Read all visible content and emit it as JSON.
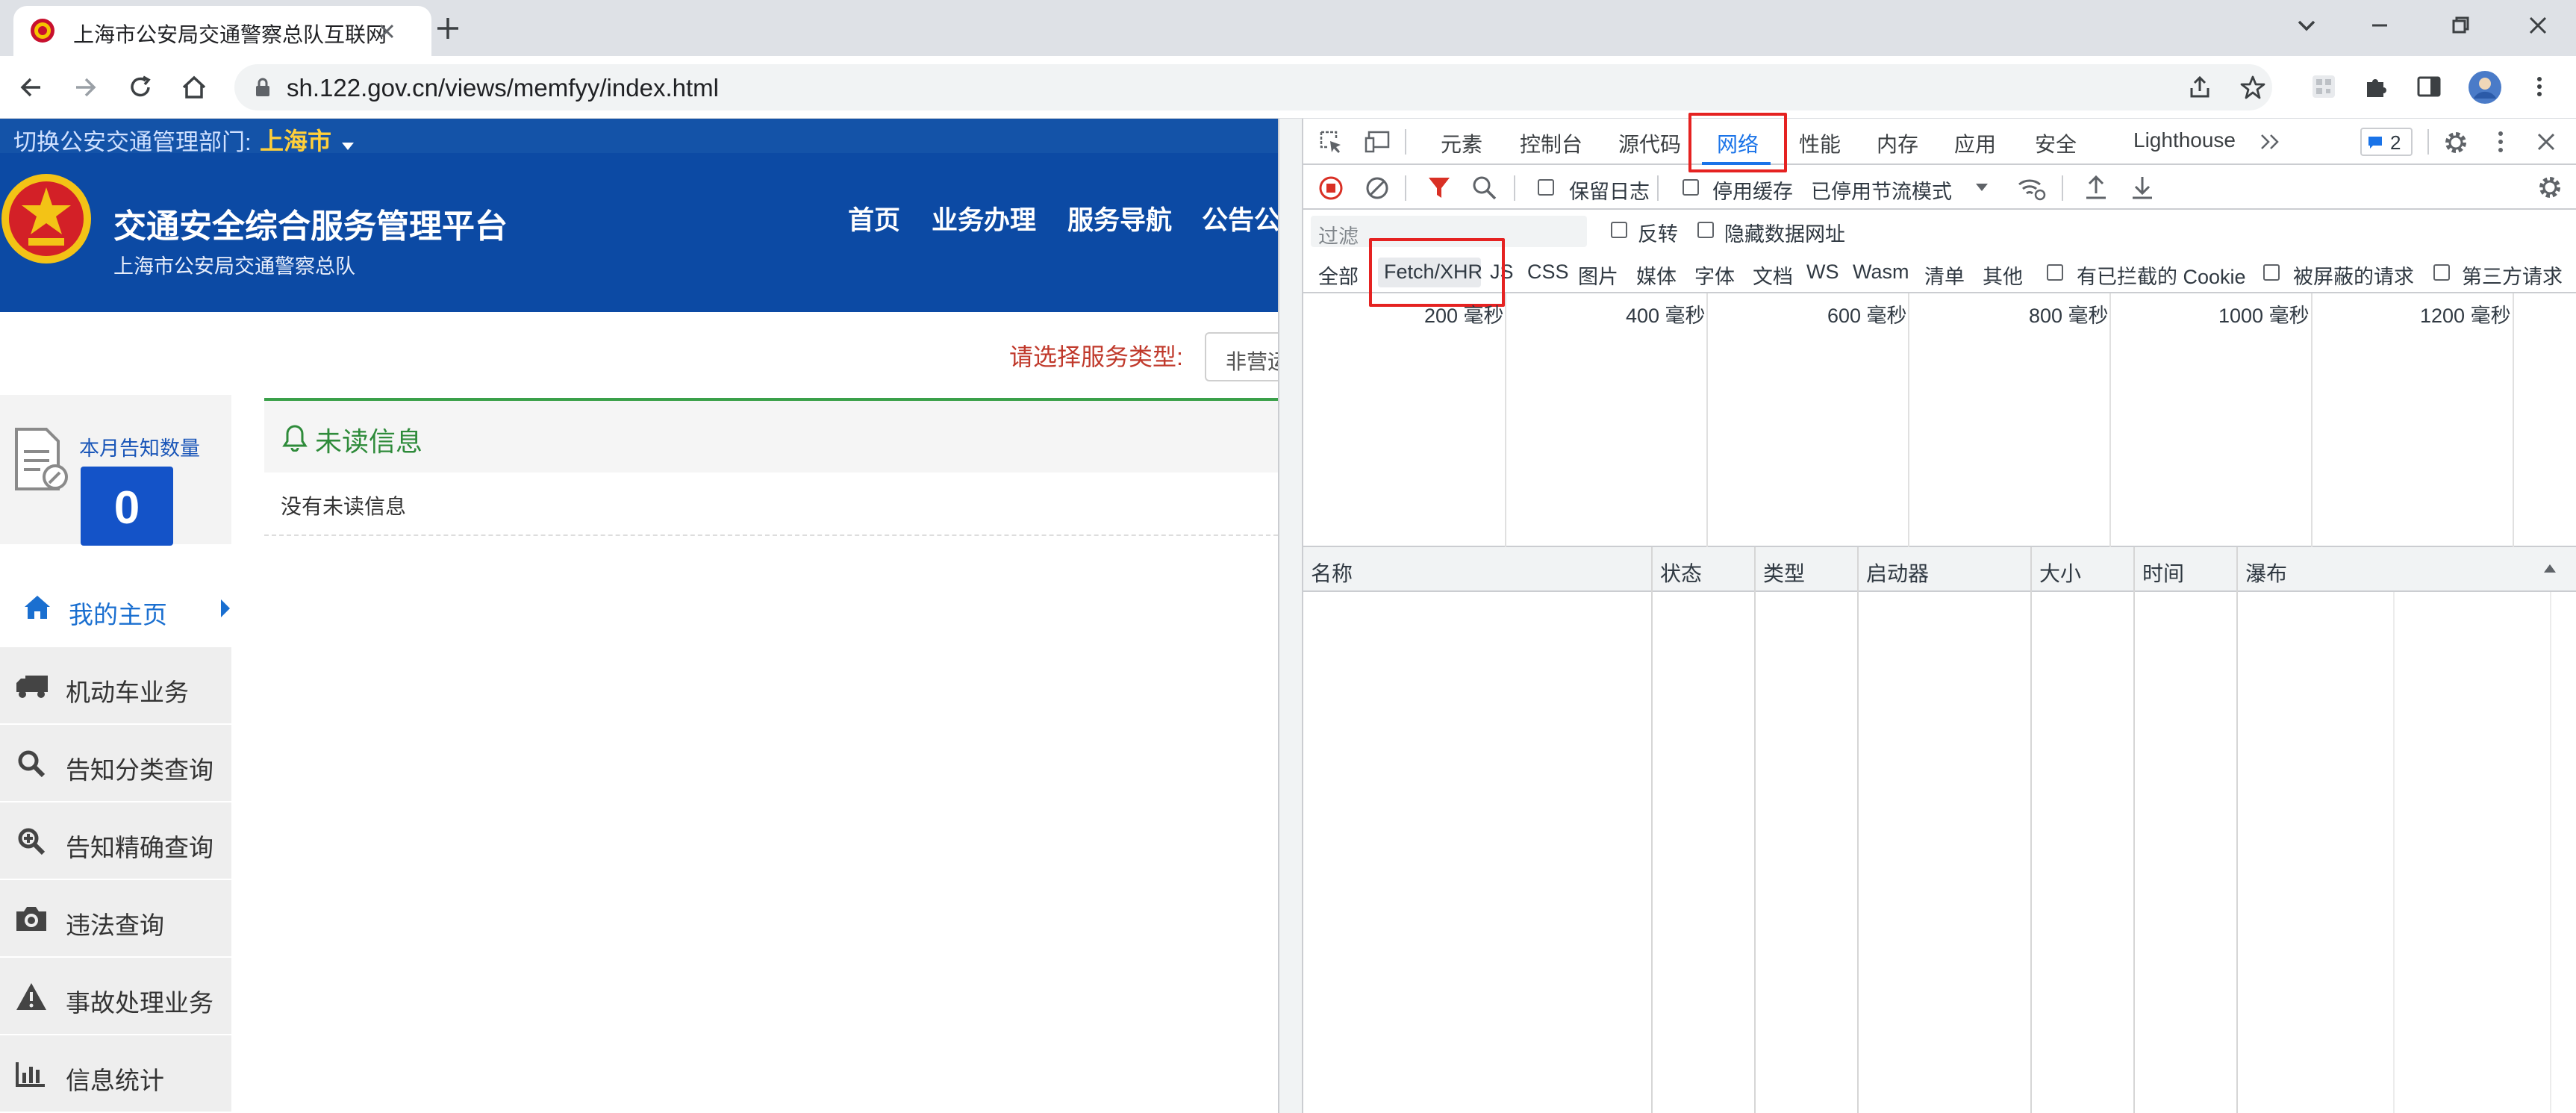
{
  "browser": {
    "tab_title": "上海市公安局交通警察总队互联网",
    "url": "sh.122.gov.cn/views/memfyy/index.html",
    "new_tab_icon": "plus-icon"
  },
  "site": {
    "switch_label": "切换公安交通管理部门:",
    "switch_city": "上海市",
    "title": "交通安全综合服务管理平台",
    "subtitle": "上海市公安局交通警察总队",
    "nav": [
      "首页",
      "业务办理",
      "服务导航",
      "公告公"
    ],
    "service_prompt": "请选择服务类型:",
    "service_value": "非营运",
    "notice_label": "本月告知数量",
    "notice_count": "0",
    "unread_title": "未读信息",
    "unread_empty": "没有未读信息",
    "sidebar": [
      "我的主页",
      "机动车业务",
      "告知分类查询",
      "告知精确查询",
      "违法查询",
      "事故处理业务",
      "信息统计"
    ]
  },
  "devtools": {
    "tabs": [
      "元素",
      "控制台",
      "源代码",
      "网络",
      "性能",
      "内存",
      "应用",
      "安全",
      "Lighthouse"
    ],
    "active_tab": "网络",
    "issues_count": "2",
    "toolbar": {
      "preserve_log": "保留日志",
      "disable_cache": "停用缓存",
      "throttle": "已停用节流模式"
    },
    "filter": {
      "placeholder": "过滤",
      "invert": "反转",
      "hide_data_urls": "隐藏数据网址"
    },
    "types": [
      "全部",
      "Fetch/XHR",
      "JS",
      "CSS",
      "图片",
      "媒体",
      "字体",
      "文档",
      "WS",
      "Wasm",
      "清单",
      "其他"
    ],
    "type_checks": [
      "有已拦截的 Cookie",
      "被屏蔽的请求",
      "第三方请求"
    ],
    "timeline_ticks": [
      "200 毫秒",
      "400 毫秒",
      "600 毫秒",
      "800 毫秒",
      "1000 毫秒",
      "1200 毫秒"
    ],
    "columns": [
      "名称",
      "状态",
      "类型",
      "启动器",
      "大小",
      "时间",
      "瀑布"
    ]
  },
  "colors": {
    "brand_blue": "#0c4aa4",
    "active_blue": "#1a73e8",
    "highlight_red": "#e52221",
    "green": "#2e8b3a",
    "prompt_red": "#c0392b"
  }
}
